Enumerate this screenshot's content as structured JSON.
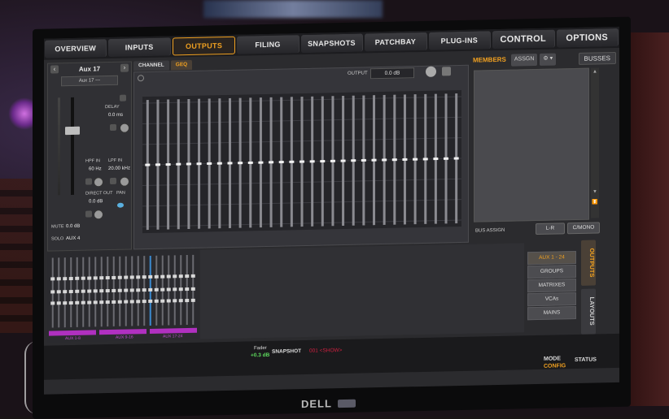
{
  "nav": {
    "tabs": [
      {
        "label": "OVERVIEW",
        "active": false
      },
      {
        "label": "INPUTS",
        "active": false
      },
      {
        "label": "OUTPUTS",
        "active": true
      },
      {
        "label": "FILING",
        "active": false
      },
      {
        "label": "SNAPSHOTS",
        "active": false
      },
      {
        "label": "PATCHBAY",
        "active": false
      },
      {
        "label": "PLUG-INS",
        "active": false
      },
      {
        "label": "CONTROL",
        "active": false
      },
      {
        "label": "OPTIONS",
        "active": false
      }
    ]
  },
  "channel": {
    "name": "Aux 17",
    "selector": "Aux 17 ---",
    "delay_label": "DELAY",
    "delay_value": "0.0 ms",
    "hpf_label": "HPF IN",
    "hpf_value": "60 Hz",
    "lpf_label": "LPF IN",
    "lpf_value": "20.00 kHz",
    "direct_out_label": "DIRECT OUT",
    "pan_label": "PAN",
    "direct_out_value": "0.0 dB",
    "mute_label": "MUTE",
    "mute_value": "0.0 dB",
    "solo_label": "SOLO",
    "solo_value": "AUX 4",
    "prev_icon": "chevron-left-icon",
    "next_icon": "chevron-right-icon"
  },
  "subtabs": [
    {
      "label": "CHANNEL",
      "active": false
    },
    {
      "label": "GEQ",
      "active": true
    }
  ],
  "geq": {
    "output_label": "OUTPUT",
    "output_value": "0.0 dB",
    "bands": 31,
    "gain_level_fraction": 0.5
  },
  "members": {
    "title": "MEMBERS",
    "assign_label": "ASSGN",
    "gear_icon": "gear-icon",
    "busses_label": "BUSSES",
    "bus_assign_label": "BUS ASSIGN",
    "lr_label": "L-R",
    "cmono_label": "C/MONO"
  },
  "bank": {
    "groups": [
      {
        "label": "AUX 1-8"
      },
      {
        "label": "AUX 9-16"
      },
      {
        "label": "AUX 17-24"
      }
    ]
  },
  "view_buttons": [
    {
      "label": "AUX 1 - 24",
      "active": true
    },
    {
      "label": "GROUPS",
      "active": false
    },
    {
      "label": "MATRIXES",
      "active": false
    },
    {
      "label": "VCAs",
      "active": false
    },
    {
      "label": "MAINS",
      "active": false
    }
  ],
  "side_tabs": [
    {
      "label": "OUTPUTS",
      "active": true
    },
    {
      "label": "LAYOUTS",
      "active": false
    }
  ],
  "status": {
    "fader_label": "Fader",
    "fader_value": "+0.3 dB",
    "snapshot_label": "SNAPSHOT",
    "snapshot_value": "001 <SHOW>",
    "mode_label": "MODE",
    "mode_value": "CONFIG",
    "status_label": "STATUS"
  },
  "monitor_brand": "DELL",
  "colors": {
    "accent": "#f0a020",
    "group_purple": "#b030c0",
    "fader_green": "#5cd85c",
    "snapshot_red": "#d02040"
  }
}
